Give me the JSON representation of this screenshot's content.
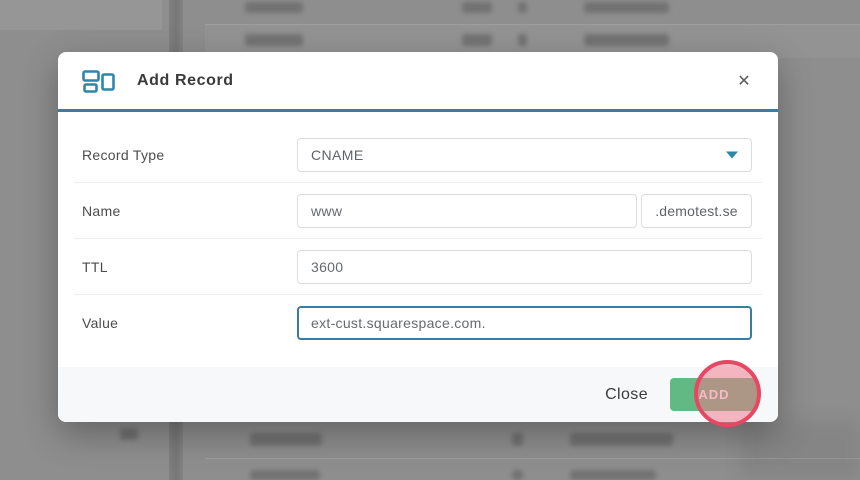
{
  "colors": {
    "accent": "#3a7d9e",
    "add-green": "#62b983",
    "annotation-pink": "#e84763",
    "backdrop": "#8e8e8e"
  },
  "modal": {
    "title": "Add Record",
    "close_icon": "✕",
    "fields": [
      {
        "label": "Record Type",
        "value": "CNAME"
      },
      {
        "label": "Name",
        "value": "www",
        "suffix": ".demotest.se"
      },
      {
        "label": "TTL",
        "value": "3600"
      },
      {
        "label": "Value",
        "value": "ext-cust.squarespace.com."
      }
    ],
    "footer": {
      "close_label": "Close",
      "add_label": "ADD"
    }
  }
}
